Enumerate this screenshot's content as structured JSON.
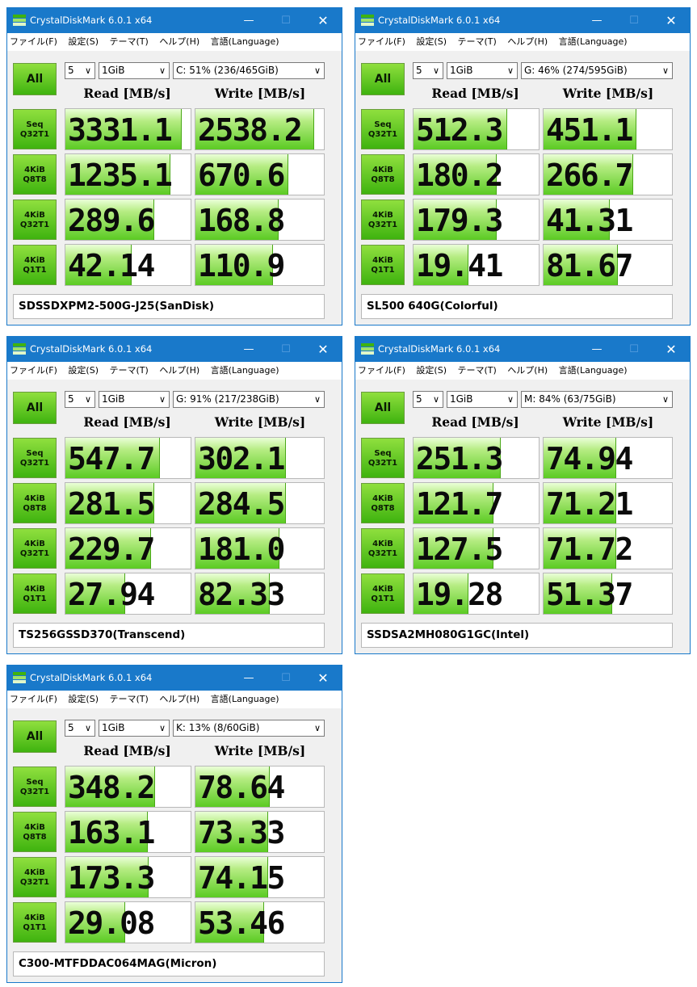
{
  "app_title": "CrystalDiskMark 6.0.1 x64",
  "menu": [
    "ファイル(F)",
    "設定(S)",
    "テーマ(T)",
    "ヘルプ(H)",
    "言語(Language)"
  ],
  "all_label": "All",
  "read_header": "Read [MB/s]",
  "write_header": "Write [MB/s]",
  "row_labels": [
    {
      "l1": "Seq",
      "l2": "Q32T1"
    },
    {
      "l1": "4KiB",
      "l2": "Q8T8"
    },
    {
      "l1": "4KiB",
      "l2": "Q32T1"
    },
    {
      "l1": "4KiB",
      "l2": "Q1T1"
    }
  ],
  "windows": [
    {
      "count": "5",
      "size": "1GiB",
      "drive": "C: 51% (236/465GiB)",
      "device": "SDSSDXPM2-500G-J25(SanDisk)",
      "results": [
        {
          "read": "3331.1",
          "write": "2538.2",
          "read_fill": 0.92,
          "write_fill": 0.92
        },
        {
          "read": "1235.1",
          "write": "670.6",
          "read_fill": 0.83,
          "write_fill": 0.72
        },
        {
          "read": "289.6",
          "write": "168.8",
          "read_fill": 0.7,
          "write_fill": 0.64
        },
        {
          "read": "42.14",
          "write": "110.9",
          "read_fill": 0.52,
          "write_fill": 0.6
        }
      ]
    },
    {
      "count": "5",
      "size": "1GiB",
      "drive": "G: 46% (274/595GiB)",
      "device": "SL500 640G(Colorful)",
      "results": [
        {
          "read": "512.3",
          "write": "451.1",
          "read_fill": 0.74,
          "write_fill": 0.72
        },
        {
          "read": "180.2",
          "write": "266.7",
          "read_fill": 0.66,
          "write_fill": 0.69
        },
        {
          "read": "179.3",
          "write": "41.31",
          "read_fill": 0.66,
          "write_fill": 0.51
        },
        {
          "read": "19.41",
          "write": "81.67",
          "read_fill": 0.43,
          "write_fill": 0.57
        }
      ]
    },
    {
      "count": "5",
      "size": "1GiB",
      "drive": "G: 91% (217/238GiB)",
      "device": "TS256GSSD370(Transcend)",
      "results": [
        {
          "read": "547.7",
          "write": "302.1",
          "read_fill": 0.75,
          "write_fill": 0.7
        },
        {
          "read": "281.5",
          "write": "284.5",
          "read_fill": 0.7,
          "write_fill": 0.7
        },
        {
          "read": "229.7",
          "write": "181.0",
          "read_fill": 0.68,
          "write_fill": 0.65
        },
        {
          "read": "27.94",
          "write": "82.33",
          "read_fill": 0.47,
          "write_fill": 0.57
        }
      ]
    },
    {
      "count": "5",
      "size": "1GiB",
      "drive": "M: 84% (63/75GiB)",
      "device": "SSDSA2MH080G1GC(Intel)",
      "results": [
        {
          "read": "251.3",
          "write": "74.94",
          "read_fill": 0.69,
          "write_fill": 0.56
        },
        {
          "read": "121.7",
          "write": "71.21",
          "read_fill": 0.63,
          "write_fill": 0.56
        },
        {
          "read": "127.5",
          "write": "71.72",
          "read_fill": 0.63,
          "write_fill": 0.56
        },
        {
          "read": "19.28",
          "write": "51.37",
          "read_fill": 0.43,
          "write_fill": 0.53
        }
      ]
    },
    {
      "count": "5",
      "size": "1GiB",
      "drive": "K: 13% (8/60GiB)",
      "device": "C300-MTFDDAC064MAG(Micron)",
      "results": [
        {
          "read": "348.2",
          "write": "78.64",
          "read_fill": 0.71,
          "write_fill": 0.57
        },
        {
          "read": "163.1",
          "write": "73.33",
          "read_fill": 0.65,
          "write_fill": 0.56
        },
        {
          "read": "173.3",
          "write": "74.15",
          "read_fill": 0.66,
          "write_fill": 0.56
        },
        {
          "read": "29.08",
          "write": "53.46",
          "read_fill": 0.47,
          "write_fill": 0.53
        }
      ]
    }
  ]
}
